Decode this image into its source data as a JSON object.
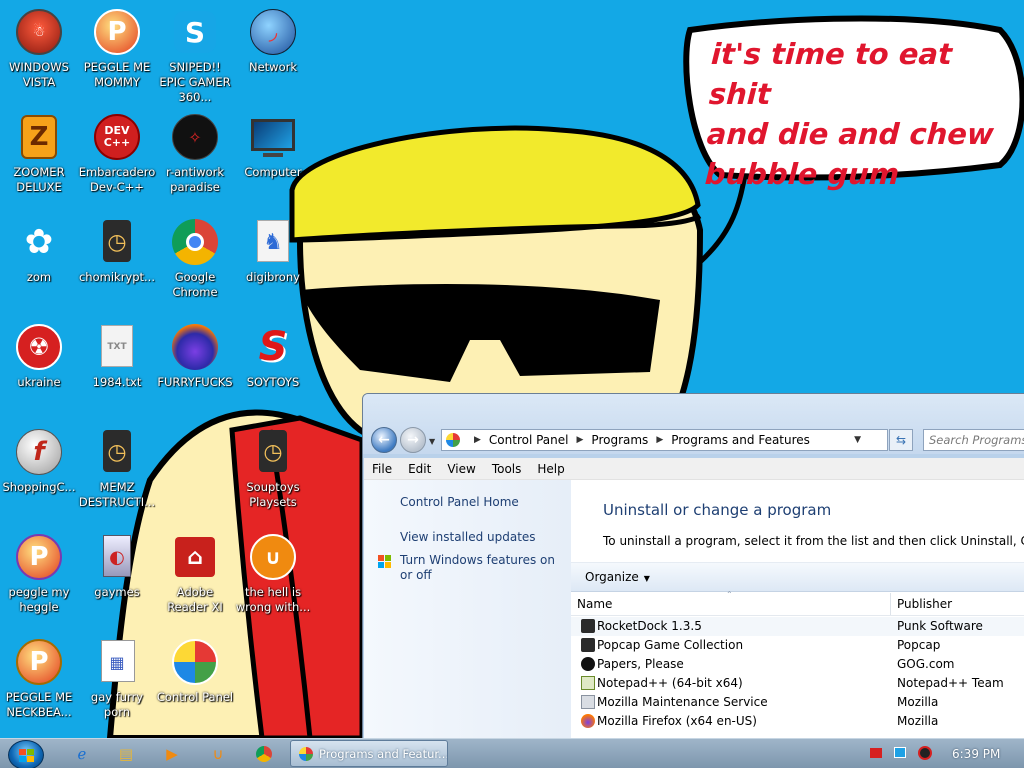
{
  "speech_bubble": [
    "it's time to eat shit",
    "and die and chew",
    "bubble gum"
  ],
  "desktop_icons": [
    {
      "label": "WINDOWS VISTA"
    },
    {
      "label": "PEGGLE ME MOMMY"
    },
    {
      "label": "SNIPED!! EPIC GAMER 360..."
    },
    {
      "label": "Network"
    },
    {
      "label": "ZOOMER DELUXE"
    },
    {
      "label": "Embarcadero Dev-C++"
    },
    {
      "label": "r-antiwork paradise"
    },
    {
      "label": "Computer"
    },
    {
      "label": "zom"
    },
    {
      "label": "chomikrypt..."
    },
    {
      "label": "Google Chrome"
    },
    {
      "label": "digibrony"
    },
    {
      "label": "ukraine"
    },
    {
      "label": "1984.txt"
    },
    {
      "label": "FURRYFUCKS"
    },
    {
      "label": "SOYTOYS"
    },
    {
      "label": "ShoppingC..."
    },
    {
      "label": "MEMZ DESTRUCTI..."
    },
    {
      "label": "Souptoys Playsets"
    },
    {
      "label": "peggle my heggle"
    },
    {
      "label": "gaymes"
    },
    {
      "label": "Adobe Reader XI"
    },
    {
      "label": "the hell is wrong with..."
    },
    {
      "label": "PEGGLE ME NECKBEA..."
    },
    {
      "label": "gay furry porn"
    },
    {
      "label": "Control Panel"
    }
  ],
  "window": {
    "address": [
      "Control Panel",
      "Programs",
      "Programs and Features"
    ],
    "search_placeholder": "Search Programs and Features",
    "menu": [
      "File",
      "Edit",
      "View",
      "Tools",
      "Help"
    ],
    "left_pane": {
      "home": "Control Panel Home",
      "updates": "View installed updates",
      "features": "Turn Windows features on or off"
    },
    "title": "Uninstall or change a program",
    "description": "To uninstall a program, select it from the list and then click Uninstall, Change, or Repair.",
    "organize": "Organize",
    "columns": {
      "name": "Name",
      "publisher": "Publisher"
    },
    "programs": [
      {
        "name": "RocketDock 1.3.5",
        "publisher": "Punk Software"
      },
      {
        "name": "Popcap Game Collection",
        "publisher": "Popcap"
      },
      {
        "name": "Papers, Please",
        "publisher": "GOG.com"
      },
      {
        "name": "Notepad++ (64-bit x64)",
        "publisher": "Notepad++ Team"
      },
      {
        "name": "Mozilla Maintenance Service",
        "publisher": "Mozilla"
      },
      {
        "name": "Mozilla Firefox (x64 en-US)",
        "publisher": "Mozilla"
      }
    ]
  },
  "taskbar": {
    "active_window": "Programs and Featur...",
    "clock": "6:39 PM"
  }
}
